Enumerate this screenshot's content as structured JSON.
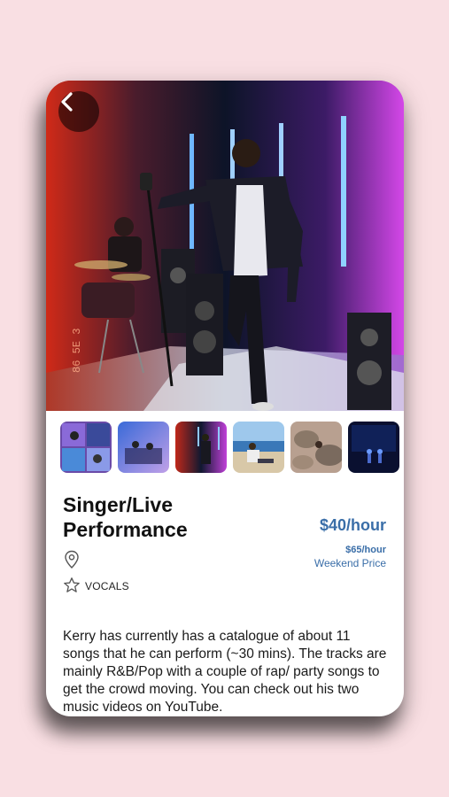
{
  "listing": {
    "title": "Singer/Live Performance",
    "price": "$40/hour",
    "weekend_price": "$65/hour",
    "weekend_label": "Weekend Price",
    "tags": [
      "VOCALS"
    ],
    "description": "Kerry has currently has a catalogue of about 11 songs that he can perform (~30 mins). The tracks are mainly R&B/Pop with a couple of rap/ party songs to get the crowd moving. You can check out his two music videos on YouTube."
  },
  "gallery": {
    "thumbnails": [
      "stage-collage",
      "band-stage",
      "performer-neon",
      "beach-sitting",
      "rocky-outdoor",
      "blue-stage"
    ]
  },
  "icons": {
    "back": "chevron-left-icon",
    "location": "location-pin-icon",
    "tag": "star-icon"
  },
  "colors": {
    "background": "#f9dfe3",
    "accent": "#3a6ea8",
    "title": "#111111"
  }
}
